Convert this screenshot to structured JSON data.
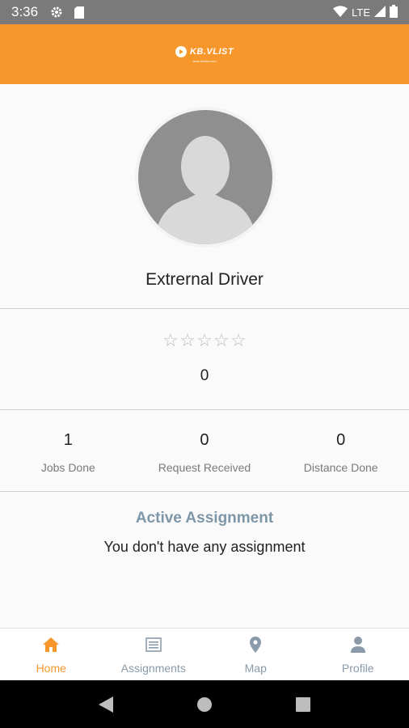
{
  "status_bar": {
    "time": "3:36",
    "network": "LTE"
  },
  "app_bar": {
    "logo_text": "KB.VLIST",
    "logo_subtext": "www.kbvlist.com",
    "brand_color": "#f7962a"
  },
  "profile": {
    "name": "Extrernal Driver"
  },
  "rating": {
    "stars_filled": 0,
    "stars_total": 5,
    "value": "0"
  },
  "stats": [
    {
      "value": "1",
      "label": "Jobs Done"
    },
    {
      "value": "0",
      "label": "Request Received"
    },
    {
      "value": "0",
      "label": "Distance Done"
    }
  ],
  "assignment": {
    "title": "Active Assignment",
    "message": "You don't have any assignment"
  },
  "bottom_nav": {
    "items": [
      {
        "label": "Home",
        "icon": "home-icon",
        "active": true
      },
      {
        "label": "Assignments",
        "icon": "list-icon",
        "active": false
      },
      {
        "label": "Map",
        "icon": "map-pin-icon",
        "active": false
      },
      {
        "label": "Profile",
        "icon": "person-icon",
        "active": false
      }
    ]
  }
}
